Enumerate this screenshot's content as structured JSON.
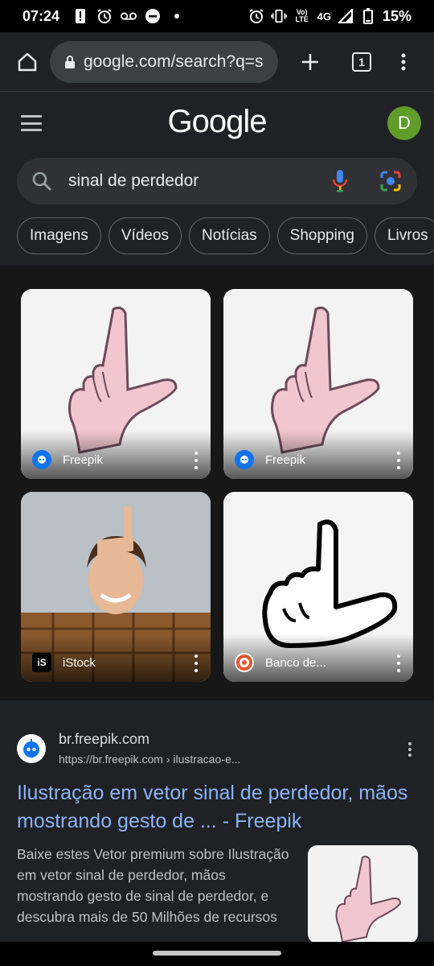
{
  "status_bar": {
    "time": "07:24",
    "network": "4G",
    "volte": "Vo) LTE",
    "battery": "15%"
  },
  "browser": {
    "url": "google.com/search?q=s",
    "tab_count": "1"
  },
  "google": {
    "logo_text": "Google",
    "avatar_letter": "D",
    "avatar_color": "#5f9c2a",
    "query": "sinal de perdedor"
  },
  "chips": [
    "Imagens",
    "Vídeos",
    "Notícias",
    "Shopping",
    "Livros"
  ],
  "images": [
    {
      "source": "Freepik",
      "icon": "freepik-icon"
    },
    {
      "source": "Freepik",
      "icon": "freepik-icon"
    },
    {
      "source": "iStock",
      "icon": "istock-icon"
    },
    {
      "source": "Banco de...",
      "icon": "canstock-icon"
    }
  ],
  "result": {
    "domain": "br.freepik.com",
    "url": "https://br.freepik.com › ilustracao-e...",
    "title": "Ilustração em vetor sinal de perdedor, mãos mostrando gesto de ... - Freepik",
    "snippet": "Baixe estes Vetor premium sobre Ilustração em vetor sinal de perdedor, mãos mostrando gesto de sinal de perdedor, e descubra mais de 50 Milhões de recursos"
  },
  "colors": {
    "background": "#202124",
    "link": "#8ab4f8",
    "search_box": "#303134"
  }
}
